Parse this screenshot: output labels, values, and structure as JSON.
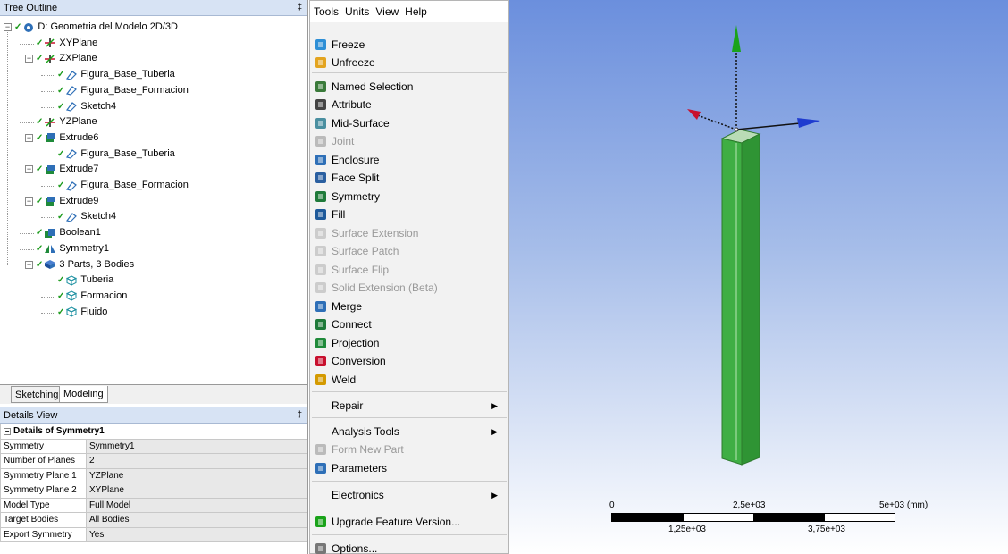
{
  "tree_outline": {
    "title": "Tree Outline",
    "pin": "‡",
    "items": [
      {
        "label": "D: Geometria del Modelo 2D/3D",
        "icon": "geometry-root-icon"
      },
      {
        "label": "XYPlane",
        "icon": "plane-icon"
      },
      {
        "label": "ZXPlane",
        "icon": "plane-icon"
      },
      {
        "label": "Figura_Base_Tuberia",
        "icon": "sketch-icon"
      },
      {
        "label": "Figura_Base_Formacion",
        "icon": "sketch-icon"
      },
      {
        "label": "Sketch4",
        "icon": "sketch-icon"
      },
      {
        "label": "YZPlane",
        "icon": "plane-icon"
      },
      {
        "label": "Extrude6",
        "icon": "extrude-icon"
      },
      {
        "label": "Figura_Base_Tuberia",
        "icon": "sketch-icon"
      },
      {
        "label": "Extrude7",
        "icon": "extrude-icon"
      },
      {
        "label": "Figura_Base_Formacion",
        "icon": "sketch-icon"
      },
      {
        "label": "Extrude9",
        "icon": "extrude-icon"
      },
      {
        "label": "Sketch4",
        "icon": "sketch-icon"
      },
      {
        "label": "Boolean1",
        "icon": "boolean-icon"
      },
      {
        "label": "Symmetry1",
        "icon": "symmetry-icon"
      },
      {
        "label": "3 Parts, 3 Bodies",
        "icon": "parts-icon"
      },
      {
        "label": "Tuberia",
        "icon": "body-icon"
      },
      {
        "label": "Formacion",
        "icon": "body-icon"
      },
      {
        "label": "Fluido",
        "icon": "body-icon"
      }
    ]
  },
  "tabs": {
    "sketching": "Sketching",
    "modeling": "Modeling"
  },
  "details": {
    "title": "Details View",
    "pin": "‡",
    "header": "Details of Symmetry1",
    "rows": [
      {
        "key": "Symmetry",
        "value": "Symmetry1"
      },
      {
        "key": "Number of Planes",
        "value": "2"
      },
      {
        "key": "Symmetry Plane 1",
        "value": "YZPlane"
      },
      {
        "key": "Symmetry Plane 2",
        "value": "XYPlane"
      },
      {
        "key": "Model Type",
        "value": "Full Model"
      },
      {
        "key": "Target Bodies",
        "value": "All Bodies"
      },
      {
        "key": "Export Symmetry",
        "value": "Yes"
      }
    ]
  },
  "menubar": [
    "Tools",
    "Units",
    "View",
    "Help"
  ],
  "menu": {
    "items": [
      {
        "label": "Freeze",
        "enabled": true
      },
      {
        "label": "Unfreeze",
        "enabled": true
      },
      {
        "label": "Named Selection",
        "enabled": true
      },
      {
        "label": "Attribute",
        "enabled": true
      },
      {
        "label": "Mid-Surface",
        "enabled": true
      },
      {
        "label": "Joint",
        "enabled": false
      },
      {
        "label": "Enclosure",
        "enabled": true
      },
      {
        "label": "Face Split",
        "enabled": true
      },
      {
        "label": "Symmetry",
        "enabled": true
      },
      {
        "label": "Fill",
        "enabled": true
      },
      {
        "label": "Surface Extension",
        "enabled": false
      },
      {
        "label": "Surface Patch",
        "enabled": false
      },
      {
        "label": "Surface Flip",
        "enabled": false
      },
      {
        "label": "Solid Extension (Beta)",
        "enabled": false
      },
      {
        "label": "Merge",
        "enabled": true
      },
      {
        "label": "Connect",
        "enabled": true
      },
      {
        "label": "Projection",
        "enabled": true
      },
      {
        "label": "Conversion",
        "enabled": true
      },
      {
        "label": "Weld",
        "enabled": true
      },
      {
        "label": "Repair",
        "enabled": true,
        "submenu": true
      },
      {
        "label": "Analysis Tools",
        "enabled": true,
        "submenu": true
      },
      {
        "label": "Form New Part",
        "enabled": false
      },
      {
        "label": "Parameters",
        "enabled": true
      },
      {
        "label": "Electronics",
        "enabled": true,
        "submenu": true
      },
      {
        "label": "Upgrade Feature Version...",
        "enabled": true
      },
      {
        "label": "Options...",
        "enabled": true
      }
    ],
    "submenu_arrow": "▶"
  },
  "viewport": {
    "scale": {
      "top_labels": [
        "0",
        "2,5e+03",
        "5e+03 (mm)"
      ],
      "bottom_labels": [
        "1,25e+03",
        "3,75e+03"
      ]
    },
    "colors": {
      "body": "#3cb043",
      "axis_y": "#1aa31a",
      "axis_x": "#c8102e",
      "axis_z": "#1f3ccf"
    }
  }
}
